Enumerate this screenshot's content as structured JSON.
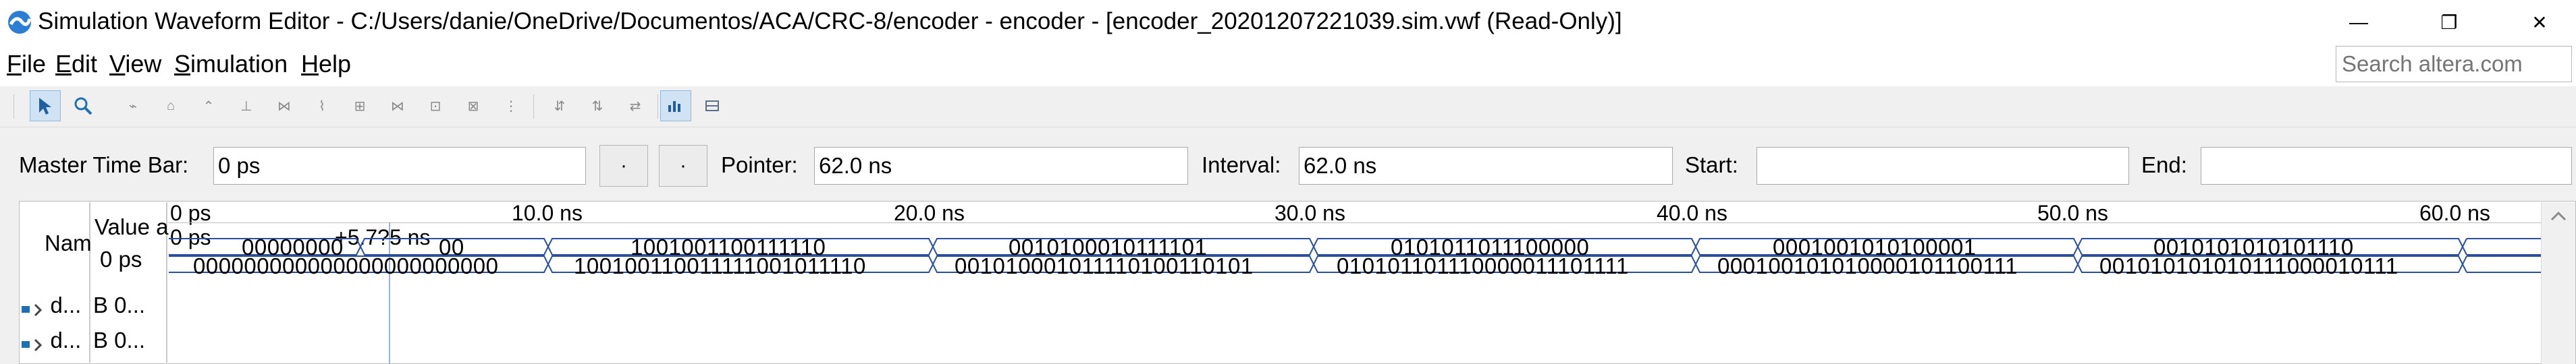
{
  "window": {
    "title": "Simulation Waveform Editor - C:/Users/danie/OneDrive/Documentos/ACA/CRC-8/encoder - encoder - [encoder_20201207221039.sim.vwf (Read-Only)]",
    "minimize_glyph": "—",
    "maximize_glyph": "❐",
    "close_glyph": "✕"
  },
  "menu": {
    "file": {
      "mnemonic": "F",
      "rest": "ile"
    },
    "edit": {
      "mnemonic": "E",
      "rest": "dit"
    },
    "view": {
      "mnemonic": "V",
      "rest": "iew"
    },
    "simulation": {
      "mnemonic": "S",
      "rest": "imulation"
    },
    "help": {
      "mnemonic": "H",
      "rest": "elp"
    }
  },
  "search": {
    "placeholder": "Search altera.com"
  },
  "toolbar": {
    "icons": [
      "select-arrow-icon",
      "zoom-icon",
      "forcing-low-icon",
      "forcing-high-icon",
      "forcing-unknown-icon",
      "forcing-high-impedance-icon",
      "weak-low-icon",
      "weak-high-icon",
      "invert-icon",
      "count-value-icon",
      "clock-icon",
      "arbitrary-value-icon",
      "random-value-icon",
      "snap-to-grid-icon",
      "sort-icon",
      "functional-sim-icon",
      "timing-sim-icon"
    ]
  },
  "timebar": {
    "master_label": "Master Time Bar:",
    "master_value": "0 ps",
    "prev_glyph": "·",
    "next_glyph": "·",
    "pointer_label": "Pointer:",
    "pointer_value": "62.0 ns",
    "interval_label": "Interval:",
    "interval_value": "62.0 ns",
    "start_label": "Start:",
    "start_value": "",
    "end_label": "End:",
    "end_value": ""
  },
  "waveform": {
    "header": {
      "name_col": "Nam",
      "value_col_line1": "Value a",
      "value_col_line2": "0 ps"
    },
    "signals": [
      {
        "name": "d...",
        "value": "B 0..."
      },
      {
        "name": "d...",
        "value": "B 0..."
      }
    ],
    "timeline": {
      "start_label": "0 ps",
      "cursor_label": "0 ps",
      "pointer_marker": "+5.7?5 ns",
      "ticks": [
        "10.0 ns",
        "20.0 ns",
        "30.0 ns",
        "40.0 ns",
        "50.0 ns",
        "60.0 ns"
      ]
    },
    "row1_values": [
      "00000000",
      "00",
      "1001001100111110",
      "0010100010111101",
      "0101011011100000",
      "0001001010100001",
      "0010101010101110"
    ],
    "row2_values": [
      "000000000000000000000000",
      "100100110011111001011110",
      "001010001011110100110101",
      "010101101110000011101111",
      "000100101010000101100111",
      "001010101010111000010111"
    ]
  }
}
